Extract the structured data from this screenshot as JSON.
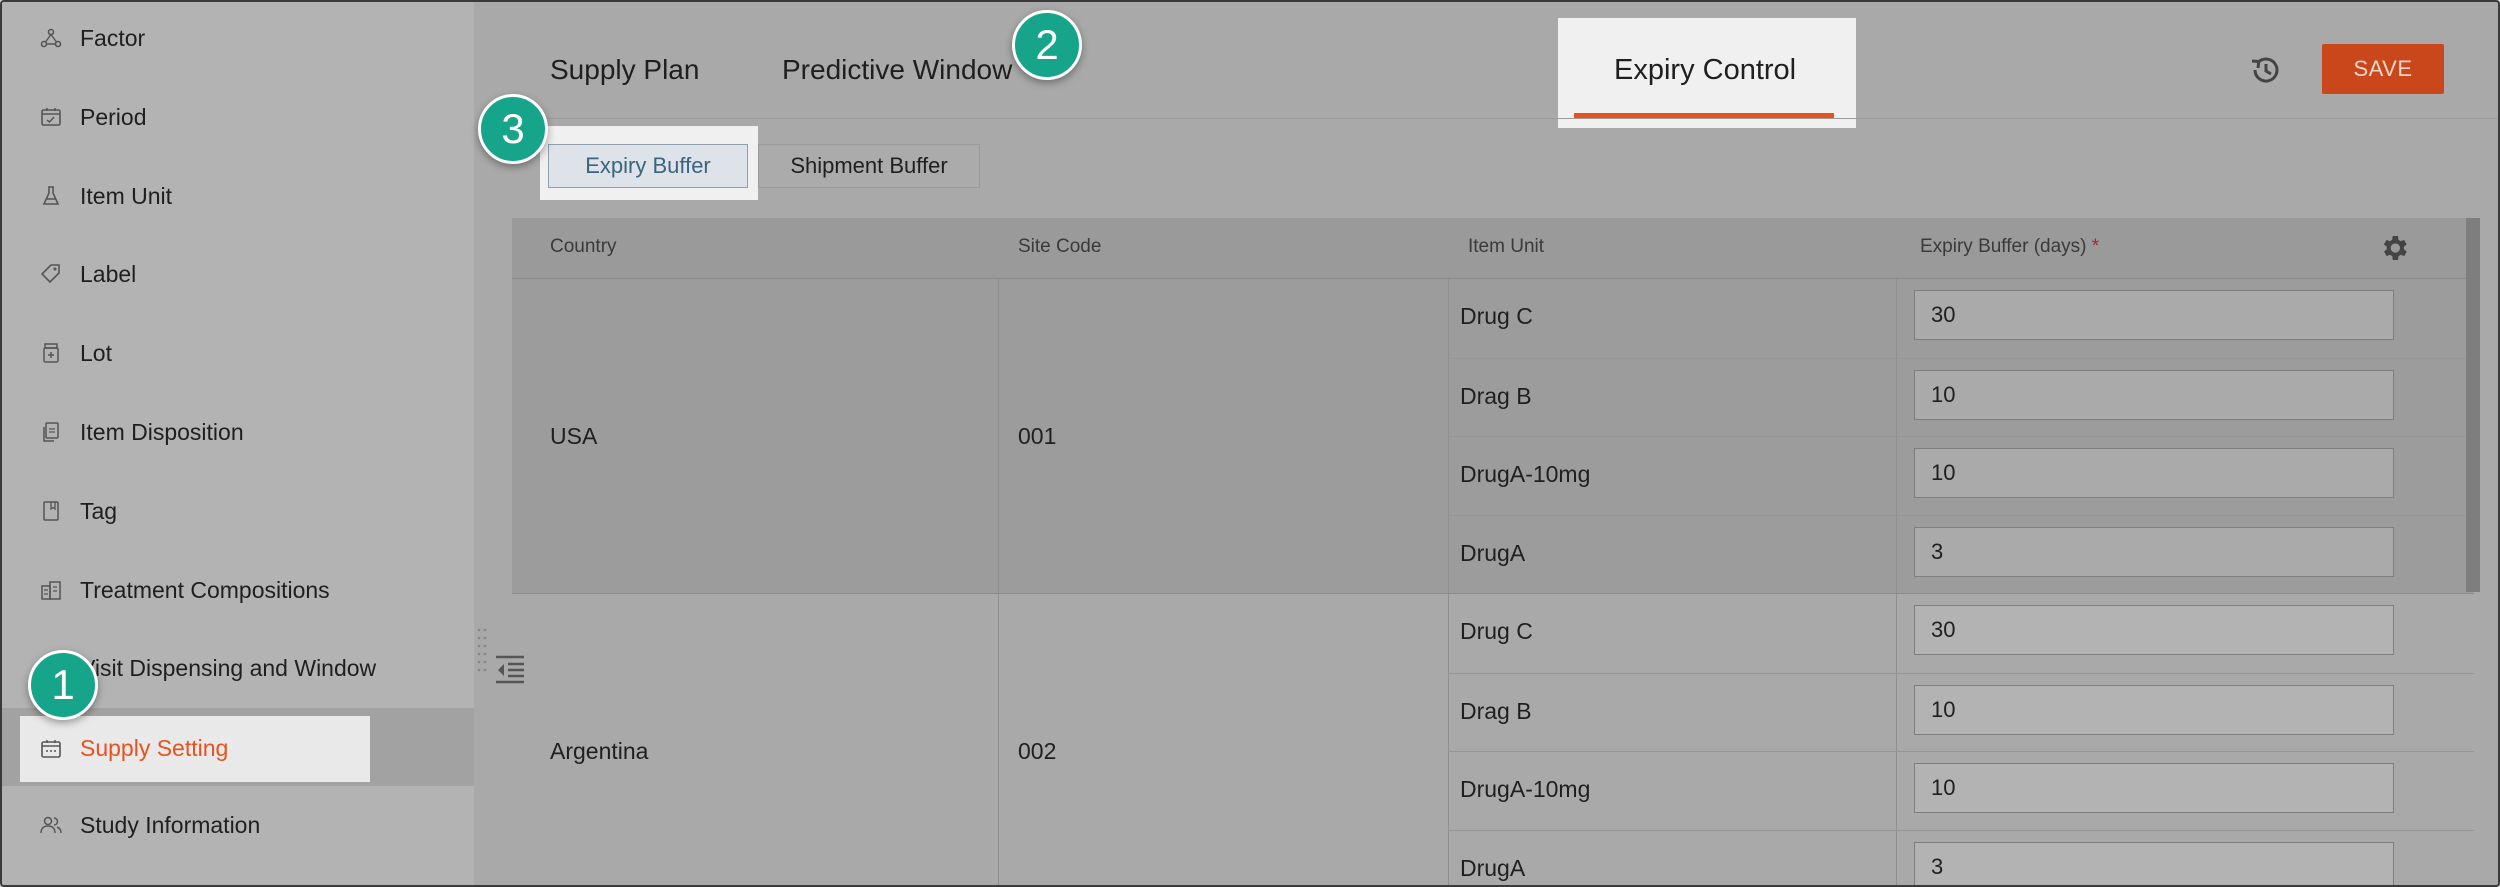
{
  "sidebar": {
    "items": [
      {
        "label": "Factor",
        "icon": "factor-icon"
      },
      {
        "label": "Period",
        "icon": "calendar-icon"
      },
      {
        "label": "Item Unit",
        "icon": "flask-icon"
      },
      {
        "label": "Label",
        "icon": "tag-icon"
      },
      {
        "label": "Lot",
        "icon": "medicine-bottle-icon"
      },
      {
        "label": "Item Disposition",
        "icon": "document-copy-icon"
      },
      {
        "label": "Tag",
        "icon": "bookmark-icon"
      },
      {
        "label": "Treatment Compositions",
        "icon": "compositions-icon"
      },
      {
        "label": "Visit Dispensing and Window",
        "icon": "visit-icon"
      },
      {
        "label": "Supply Setting",
        "icon": "supply-calendar-icon"
      },
      {
        "label": "Study Information",
        "icon": "people-icon"
      }
    ],
    "active_index": 9,
    "active_color": "#e8521f"
  },
  "tabs": [
    {
      "label": "Supply Plan"
    },
    {
      "label": "Predictive Window"
    },
    {
      "label": "Expiry Control"
    }
  ],
  "active_tab_index": 2,
  "toolbar": {
    "save_label": "SAVE",
    "history_icon": "history-icon"
  },
  "subtabs": [
    {
      "label": "Expiry Buffer"
    },
    {
      "label": "Shipment Buffer"
    }
  ],
  "table": {
    "headers": {
      "country": "Country",
      "site_code": "Site Code",
      "item_unit": "Item Unit",
      "expiry_buffer": "Expiry Buffer (days)",
      "required_mark": "*"
    },
    "groups": [
      {
        "country": "USA",
        "site_code": "001",
        "rows": [
          {
            "item_unit": "Drug C",
            "expiry_buffer": "30"
          },
          {
            "item_unit": "Drag B",
            "expiry_buffer": "10"
          },
          {
            "item_unit": "DrugA-10mg",
            "expiry_buffer": "10"
          },
          {
            "item_unit": "DrugA",
            "expiry_buffer": "3"
          }
        ]
      },
      {
        "country": "Argentina",
        "site_code": "002",
        "rows": [
          {
            "item_unit": "Drug C",
            "expiry_buffer": "30"
          },
          {
            "item_unit": "Drag B",
            "expiry_buffer": "10"
          },
          {
            "item_unit": "DrugA-10mg",
            "expiry_buffer": "10"
          },
          {
            "item_unit": "DrugA",
            "expiry_buffer": "3"
          }
        ]
      }
    ]
  },
  "annotations": {
    "step1": "1",
    "step2": "2",
    "step3": "3",
    "color": "#16a58b"
  }
}
